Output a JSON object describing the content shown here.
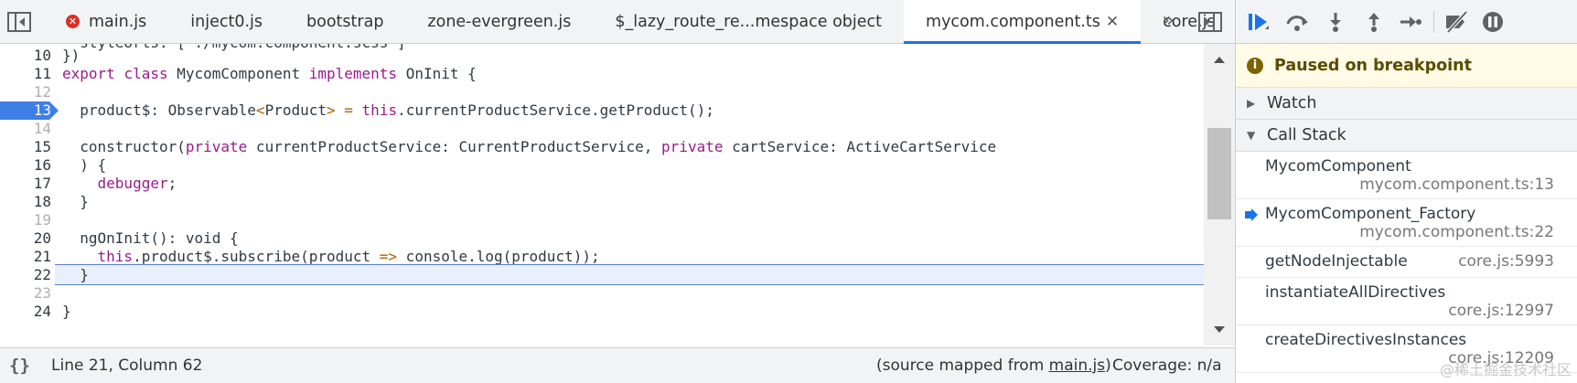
{
  "tabs": [
    {
      "label": "main.js",
      "error": true,
      "active": false
    },
    {
      "label": "inject0.js",
      "error": false,
      "active": false
    },
    {
      "label": "bootstrap",
      "error": false,
      "active": false
    },
    {
      "label": "zone-evergreen.js",
      "error": false,
      "active": false
    },
    {
      "label": "$_lazy_route_re...mespace object",
      "error": false,
      "active": false
    },
    {
      "label": "mycom.component.ts",
      "error": false,
      "active": true,
      "closable": true
    },
    {
      "label": "core.js",
      "error": false,
      "active": false
    }
  ],
  "tab_more_label": "»",
  "code": {
    "partial_top_line": "  styleUrls: ['./mycom.component.scss']",
    "lines": [
      {
        "n": "10",
        "text": "})"
      },
      {
        "n": "11",
        "text": "export class MycomComponent implements OnInit {"
      },
      {
        "n": "12",
        "text": ""
      },
      {
        "n": "13",
        "text": "  product$: Observable<Product> = this.currentProductService.getProduct();",
        "breakpoint": true
      },
      {
        "n": "14",
        "text": ""
      },
      {
        "n": "15",
        "text": "  constructor(private currentProductService: CurrentProductService, private cartService: ActiveCartService"
      },
      {
        "n": "16",
        "text": "  ) {"
      },
      {
        "n": "17",
        "text": "    debugger;"
      },
      {
        "n": "18",
        "text": "  }"
      },
      {
        "n": "19",
        "text": ""
      },
      {
        "n": "20",
        "text": "  ngOnInit(): void {"
      },
      {
        "n": "21",
        "text": "    this.product$.subscribe(product => console.log(product));"
      },
      {
        "n": "22",
        "text": "  }",
        "current": true
      },
      {
        "n": "23",
        "text": ""
      },
      {
        "n": "24",
        "text": "}"
      }
    ]
  },
  "status": {
    "pretty_print": "{}",
    "cursor": "Line 21, Column 62",
    "source_map_prefix": "(source mapped from ",
    "source_map_link": "main.js",
    "source_map_suffix": ")",
    "coverage": "Coverage: n/a"
  },
  "debugger": {
    "paused_text": "Paused on breakpoint",
    "paused_icon": "i",
    "watch_label": "Watch",
    "callstack_label": "Call Stack",
    "frames": [
      {
        "fn": "MycomComponent",
        "loc": "mycom.component.ts:13",
        "current": false
      },
      {
        "fn": "MycomComponent_Factory",
        "loc": "mycom.component.ts:22",
        "current": true
      },
      {
        "fn": "getNodeInjectable",
        "loc": "core.js:5993",
        "current": false
      },
      {
        "fn": "instantiateAllDirectives",
        "loc": "core.js:12997",
        "current": false
      },
      {
        "fn": "createDirectivesInstances",
        "loc": "core.js:12209",
        "current": false
      }
    ],
    "watermark": "@稀土掘金技术社区"
  },
  "colors": {
    "accent": "#1a73e8",
    "debugger_blue": "#1a73e8",
    "breakpoint": "#3f7ee6",
    "paused_bg": "#fffbe6",
    "error": "#d93025"
  }
}
